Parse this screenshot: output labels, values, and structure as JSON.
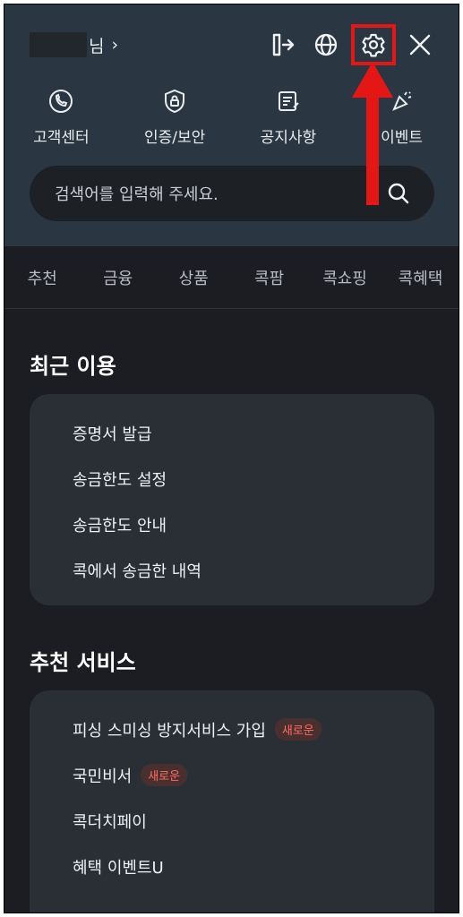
{
  "topbar": {
    "user_suffix": "님",
    "chevron": "›",
    "icons": [
      "logout-icon",
      "globe-icon",
      "gear-icon",
      "close-icon"
    ]
  },
  "quick_menu": [
    {
      "label": "고객센터",
      "icon": "phone-icon"
    },
    {
      "label": "인증/보안",
      "icon": "shield-lock-icon"
    },
    {
      "label": "공지사항",
      "icon": "notice-icon"
    },
    {
      "label": "이벤트",
      "icon": "event-icon"
    }
  ],
  "search": {
    "placeholder": "검색어를 입력해 주세요."
  },
  "tabs": [
    "추천",
    "금융",
    "상품",
    "콕팜",
    "콕쇼핑",
    "콕혜택"
  ],
  "recent": {
    "title": "최근 이용",
    "items": [
      "증명서 발급",
      "송금한도 설정",
      "송금한도 안내",
      "콕에서 송금한 내역"
    ]
  },
  "recommend": {
    "title": "추천 서비스",
    "items": [
      {
        "label": "피싱 스미싱 방지서비스 가입",
        "badge": "새로운"
      },
      {
        "label": "국민비서",
        "badge": "새로운"
      },
      {
        "label": "콕더치페이",
        "badge": ""
      },
      {
        "label": "혜택 이벤트U",
        "badge": ""
      }
    ]
  },
  "colors": {
    "background": "#1c1d22",
    "header": "#2a3641",
    "card": "#2a2f35",
    "highlight": "#e51616",
    "badge_text": "#ff6b5f"
  }
}
